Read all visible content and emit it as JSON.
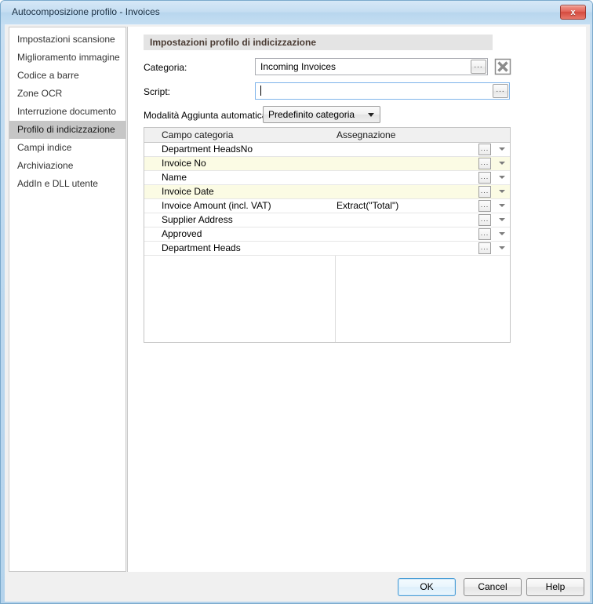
{
  "window": {
    "title": "Autocomposizione profilo - Invoices",
    "close_label": "x"
  },
  "sidebar": {
    "items": [
      {
        "label": "Impostazioni scansione",
        "selected": false
      },
      {
        "label": "Miglioramento immagine",
        "selected": false
      },
      {
        "label": "Codice a barre",
        "selected": false
      },
      {
        "label": "Zone OCR",
        "selected": false
      },
      {
        "label": "Interruzione documento",
        "selected": false
      },
      {
        "label": "Profilo di indicizzazione",
        "selected": true
      },
      {
        "label": "Campi indice",
        "selected": false
      },
      {
        "label": "Archiviazione",
        "selected": false
      },
      {
        "label": "AddIn e DLL utente",
        "selected": false
      }
    ]
  },
  "main": {
    "group_header": "Impostazioni profilo di indicizzazione",
    "categoria": {
      "label": "Categoria:",
      "value": "Incoming Invoices",
      "browse_label": "...",
      "clear_icon": "x-delete-icon"
    },
    "script": {
      "label": "Script:",
      "value": "",
      "placeholder": "",
      "browse_label": "...",
      "focused": true
    },
    "modalita": {
      "label": "Modalità Aggiunta automatica:",
      "value": "Predefinito categoria",
      "options": [
        "Predefinito categoria"
      ]
    },
    "grid": {
      "columns": [
        "Campo categoria",
        "Assegnazione"
      ],
      "row_browse_label": "...",
      "rows": [
        {
          "field": "Department HeadsNo",
          "assignment": "",
          "highlight": false
        },
        {
          "field": "Invoice No",
          "assignment": "",
          "highlight": true
        },
        {
          "field": "Name",
          "assignment": "",
          "highlight": false
        },
        {
          "field": "Invoice Date",
          "assignment": "",
          "highlight": true
        },
        {
          "field": "Invoice Amount (incl. VAT)",
          "assignment": "Extract(\"Total\")",
          "highlight": false
        },
        {
          "field": "Supplier Address",
          "assignment": "",
          "highlight": false
        },
        {
          "field": "Approved",
          "assignment": "",
          "highlight": false
        },
        {
          "field": "Department Heads",
          "assignment": "",
          "highlight": false
        }
      ]
    }
  },
  "footer": {
    "ok": "OK",
    "cancel": "Cancel",
    "help": "Help"
  },
  "colors": {
    "title_bar": "#c6def2",
    "selected_item": "#c6c6c6",
    "row_highlight": "#fbfbe4",
    "close_button": "#d44a3e",
    "focus_border": "#7eb4ea"
  }
}
